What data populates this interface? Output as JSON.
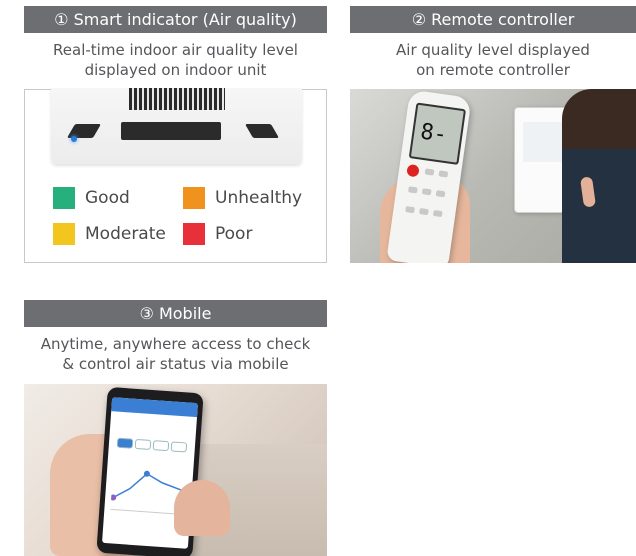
{
  "panels": [
    {
      "title": "① Smart indicator (Air quality)",
      "subtitle_lines": [
        "Real-time indoor air quality level",
        "displayed on indoor unit"
      ],
      "legend": [
        {
          "label": "Good",
          "color": "#27b07e"
        },
        {
          "label": "Unhealthy",
          "color": "#f0921e"
        },
        {
          "label": "Moderate",
          "color": "#f2c51f"
        },
        {
          "label": "Poor",
          "color": "#e8303a"
        }
      ]
    },
    {
      "title": "② Remote controller",
      "subtitle_lines": [
        "Air quality level displayed",
        "on remote controller"
      ],
      "remote_display": "8-"
    },
    {
      "title": "③ Mobile",
      "subtitle_lines": [
        "Anytime, anywhere access to check",
        "& control air status via mobile"
      ]
    }
  ],
  "colors": {
    "header_bg": "#6d6e71",
    "subtitle_text": "#55565a"
  }
}
